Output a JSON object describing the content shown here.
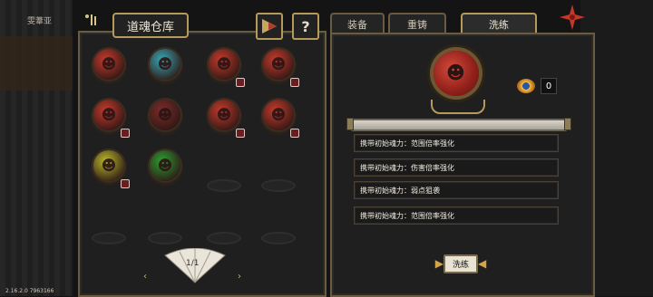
{
  "background": {
    "top_label": "雯葦亚",
    "version": "2.16.2.0 7963166"
  },
  "left": {
    "title": "道魂仓库",
    "help_label": "?",
    "pager": {
      "label": "1/1",
      "prev": "‹",
      "next": "›"
    },
    "orbs": [
      {
        "color": "#c23b2d",
        "badge": false
      },
      {
        "color": "#3aa6b3",
        "badge": false
      },
      {
        "color": "#c23b2d",
        "badge": true
      },
      {
        "color": "#c23b2d",
        "badge": true
      },
      {
        "color": "#c23b2d",
        "badge": true
      },
      {
        "color": "#7b2d2a",
        "badge": false
      },
      {
        "color": "#c23b2d",
        "badge": true
      },
      {
        "color": "#c23b2d",
        "badge": true
      },
      {
        "color": "#b8b62d",
        "badge": true
      },
      {
        "color": "#2f9b33",
        "badge": false
      }
    ]
  },
  "right": {
    "tabs": [
      "装备",
      "重铸",
      "洗练"
    ],
    "active_tab": 2,
    "currency_count": "0",
    "attributes": [
      "携带初始魂力：范围倍率强化",
      "携带初始魂力：伤害倍率强化",
      "携带初始魂力：弱点狙袭",
      "携带初始魂力：范围倍率强化"
    ],
    "action_label": "洗练"
  }
}
